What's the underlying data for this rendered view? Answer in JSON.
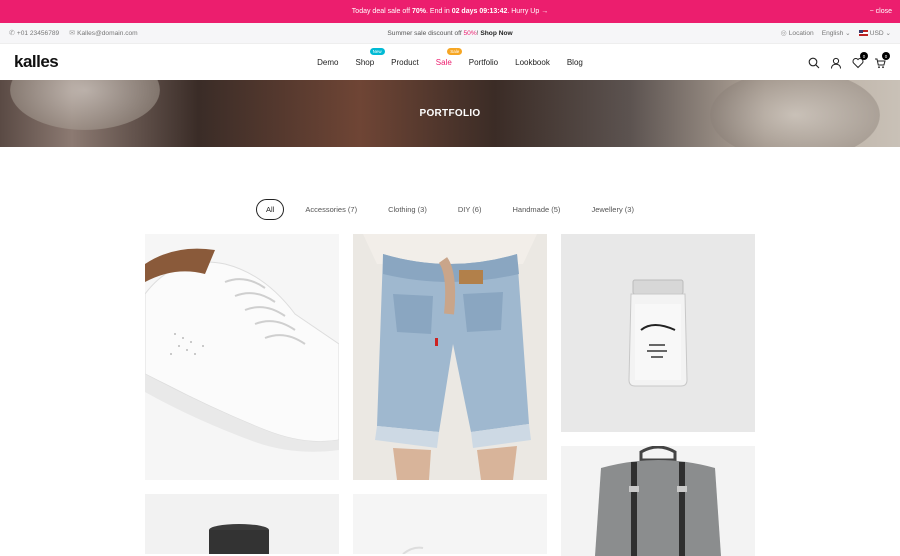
{
  "promo": {
    "text_before": "Today deal sale off ",
    "percent": "70%",
    "text_mid": ". End in ",
    "countdown": "02 days 09:13:42",
    "text_after": ". Hurry Up →",
    "close_label": "− close"
  },
  "topbar": {
    "phone": "+01 23456789",
    "email": "Kalles@domain.com",
    "summer_text": "Summer sale discount off ",
    "summer_percent": "50%",
    "summer_bang": "! ",
    "shop_now": "Shop Now",
    "location": "Location",
    "language": "English",
    "currency": "USD"
  },
  "header": {
    "logo": "kalles",
    "nav": [
      {
        "label": "Demo"
      },
      {
        "label": "Shop",
        "badge": "New"
      },
      {
        "label": "Product"
      },
      {
        "label": "Sale",
        "badge": "Sale"
      },
      {
        "label": "Portfolio"
      },
      {
        "label": "Lookbook"
      },
      {
        "label": "Blog"
      }
    ],
    "wishlist_count": "0",
    "cart_count": "0"
  },
  "hero": {
    "title": "PORTFOLIO"
  },
  "filters": [
    "All",
    "Accessories (7)",
    "Clothing (3)",
    "DIY (6)",
    "Handmade (5)",
    "Jewellery (3)"
  ],
  "colors": {
    "accent": "#ec1e6e",
    "new_badge": "#01bad4",
    "hot_badge": "#f6a623"
  }
}
